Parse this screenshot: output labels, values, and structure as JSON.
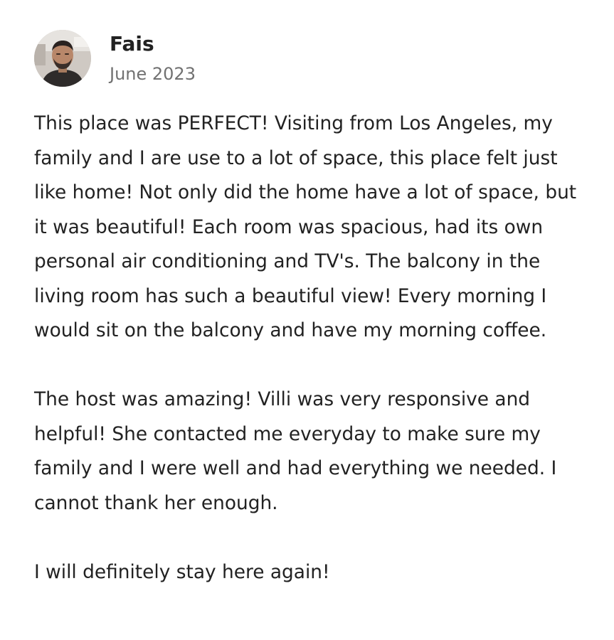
{
  "reviewer": {
    "name": "Fais",
    "date": "June 2023",
    "avatar_icon": "reviewer-avatar-photo"
  },
  "review": {
    "paragraphs": [
      "This place was PERFECT! Visiting from Los Angeles, my family and I are use to a lot of space, this place felt just like home! Not only did the home have a lot of space, but it was beautiful! Each room was spacious, had its own personal air conditioning and TV's. The balcony in the living room has such a beautiful view! Every morning I would sit on the balcony and have my morning coffee.",
      "The host was amazing! Villi was very responsive and helpful! She contacted me everyday to make sure my family and I were well and had everything we needed. I cannot thank her enough.",
      "I will definitely stay here again!"
    ]
  },
  "colors": {
    "text_primary": "#222222",
    "text_secondary": "#717171",
    "background": "#ffffff"
  }
}
